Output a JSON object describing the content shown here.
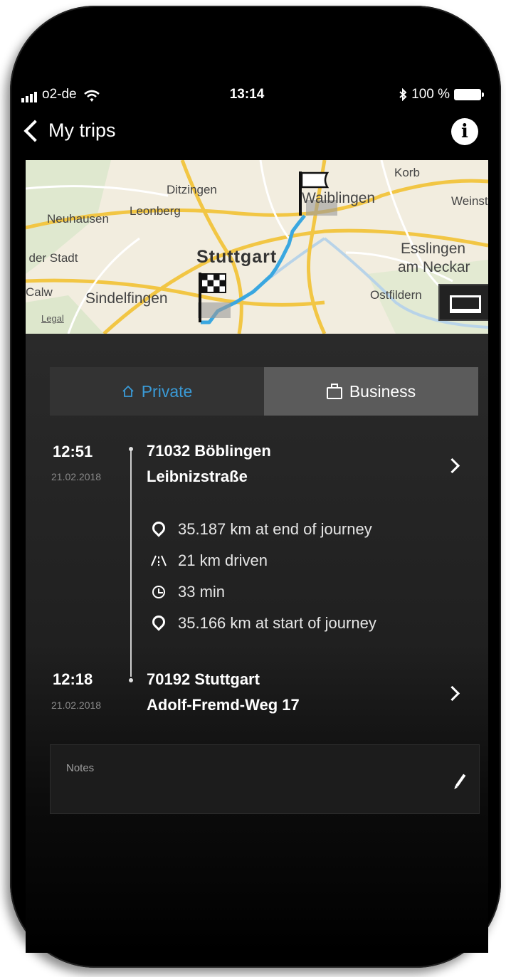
{
  "status_bar": {
    "carrier": "o2-de",
    "time": "13:14",
    "battery": "100 %",
    "icons": [
      "signal-icon",
      "wifi-icon",
      "bluetooth-icon",
      "battery-icon"
    ]
  },
  "nav": {
    "back_label": "My trips",
    "info_glyph": "i"
  },
  "map": {
    "places": [
      "Korb",
      "Ditzingen",
      "Waiblingen",
      "Weinsta",
      "Neuhausen",
      "Leonberg",
      "Stuttgart",
      "Esslingen",
      "am Neckar",
      "l der Stadt",
      "Calw",
      "Sindelfingen",
      "Ostfildern",
      "Legal"
    ],
    "route_color": "#3aa7e0"
  },
  "segment": {
    "private_label": "Private",
    "business_label": "Business",
    "selected": "Business",
    "accent": "#3a9ad6"
  },
  "trip": {
    "end": {
      "time": "12:51",
      "date": "21.02.2018",
      "postal_city": "71032 Böblingen",
      "street": "Leibnizstraße"
    },
    "details": [
      {
        "icon": "pin-icon",
        "text": "35.187 km at end of journey"
      },
      {
        "icon": "road-icon",
        "text": "21 km driven"
      },
      {
        "icon": "clock-icon",
        "text": "33 min"
      },
      {
        "icon": "pin-icon",
        "text": "35.166 km at start of journey"
      }
    ],
    "start": {
      "time": "12:18",
      "date": "21.02.2018",
      "postal_city": "70192 Stuttgart",
      "street": "Adolf-Fremd-Weg 17"
    }
  },
  "notes": {
    "label": "Notes"
  }
}
